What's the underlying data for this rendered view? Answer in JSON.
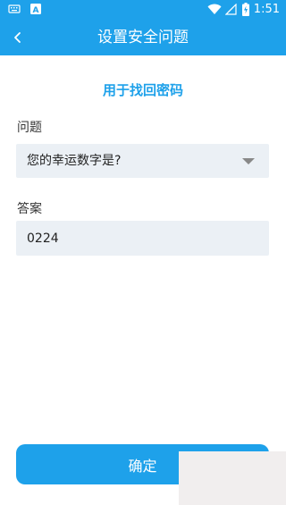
{
  "status_bar": {
    "time": "1:51",
    "left_icons": [
      "keyboard-icon",
      "font-a-icon"
    ],
    "right_icons": [
      "wifi-icon",
      "signal-icon",
      "battery-charging-icon"
    ]
  },
  "header": {
    "title": "设置安全问题",
    "back_icon": "chevron-left-icon"
  },
  "form": {
    "subtitle": "用于找回密码",
    "question_label": "问题",
    "question_value": "您的幸运数字是?",
    "answer_label": "答案",
    "answer_value": "0224"
  },
  "footer": {
    "confirm_label": "确定"
  },
  "colors": {
    "primary": "#1ea1ea",
    "field_bg": "#ebf0f5"
  }
}
